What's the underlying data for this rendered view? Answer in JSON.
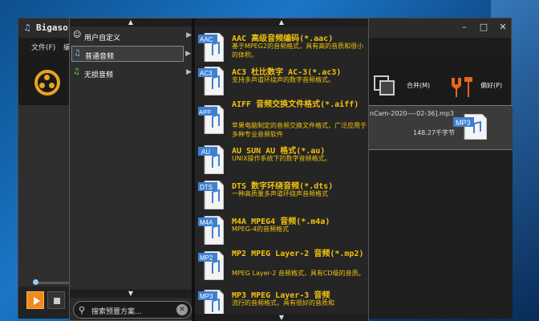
{
  "app": {
    "title": "Bigasof",
    "menu": [
      "文件(F)",
      "编"
    ]
  },
  "toolbar": {
    "merge_label": "合并(M)",
    "prefs_label": "偏好(P)"
  },
  "file": {
    "name": "nCam-2020----02-36].mp3",
    "size": "148.27千字节",
    "badge": "MP3"
  },
  "popup": {
    "categories": [
      {
        "label": "用户自定义",
        "icon": "user-icon"
      },
      {
        "label": "普通音频",
        "icon": "music-note-icon"
      },
      {
        "label": "无损音频",
        "icon": "music-note-icon"
      }
    ],
    "search_placeholder": "搜索预置方案...",
    "formats": [
      {
        "badge": "AAC",
        "title": "AAC 高级音频编码(*.aac)",
        "desc": "基于MPEG2的音频格式，具有高的音质和很小的体积。"
      },
      {
        "badge": "AC3",
        "title": "AC3 杜比数字 AC-3(*.ac3)",
        "desc": "支持多声道环绕声的数字音频格式。"
      },
      {
        "badge": "AIFF",
        "title": "AIFF 音频交换文件格式(*.aiff)",
        "desc": "苹果电脑制定的音频交换文件格式，广泛应用于多种专业音频软件"
      },
      {
        "badge": "AU",
        "title": "AU SUN AU 格式(*.au)",
        "desc": "UNIX操作系统下的数字音频格式。"
      },
      {
        "badge": "DTS",
        "title": "DTS 数字环绕音频(*.dts)",
        "desc": "一种高质量多声道环绕声音频格式"
      },
      {
        "badge": "M4A",
        "title": "M4A MPEG4 音频(*.m4a)",
        "desc": "MPEG-4的音频格式"
      },
      {
        "badge": "MP2",
        "title": "MP2 MPEG Layer-2 音频(*.mp2)",
        "desc": "MPEG Layer-2 音频格式，具有CD级的音质。"
      },
      {
        "badge": "MP3",
        "title": "MP3 MPEG Layer-3 音频",
        "desc": "流行的音频格式，具有很好的音质和"
      }
    ]
  },
  "colors": {
    "accent_orange": "#f08a1c",
    "format_text": "#f2c20d",
    "file_badge": "#3d7fd0"
  }
}
